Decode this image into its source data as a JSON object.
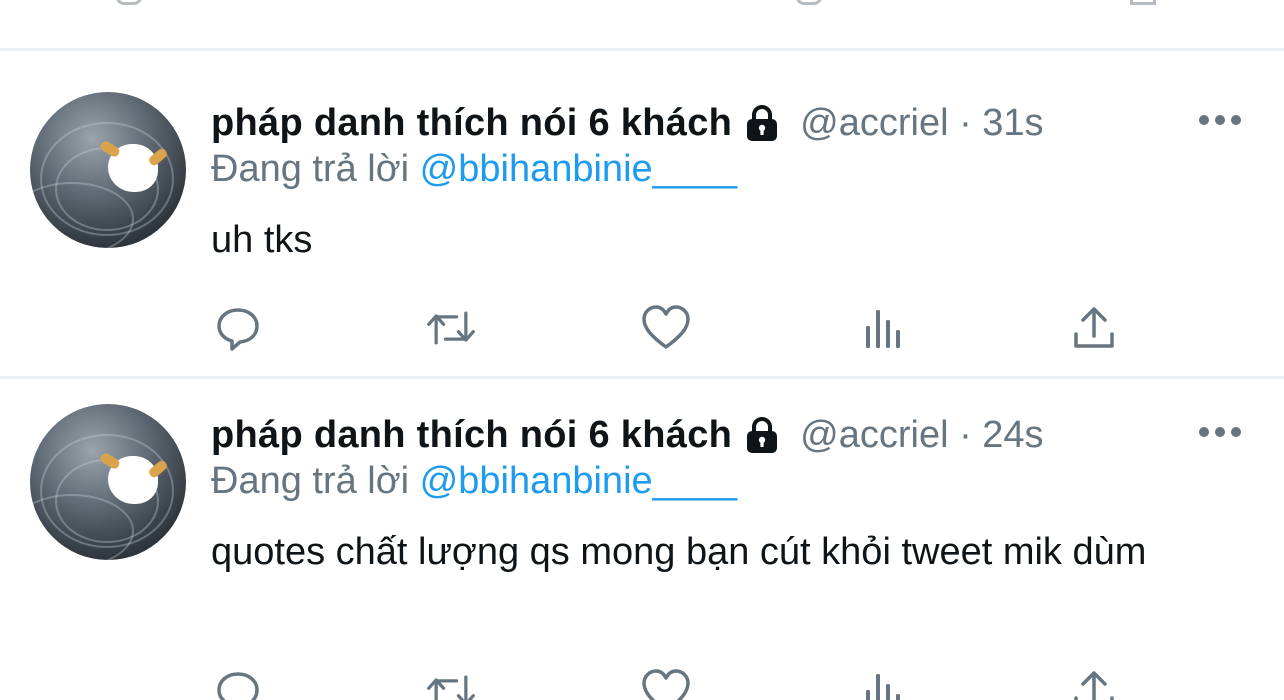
{
  "tweets": [
    {
      "display_name": "pháp danh thích nói 6 khách",
      "handle_time": "@accriel · 31s",
      "reply_prefix": "Đang trả lời",
      "reply_mention": "@bbihanbinie____",
      "text": "uh tks"
    },
    {
      "display_name": "pháp danh thích nói 6 khách",
      "handle_time": "@accriel · 24s",
      "reply_prefix": "Đang trả lời",
      "reply_mention": "@bbihanbinie____",
      "text": "quotes chất lượng qs mong bạn cút khỏi tweet mik dùm"
    }
  ],
  "icons": {
    "lock": "lock-icon",
    "more": "more-icon",
    "reply": "reply-icon",
    "retweet": "retweet-icon",
    "like": "heart-icon",
    "analytics": "analytics-icon",
    "share": "share-icon"
  },
  "colors": {
    "text": "#0f1419",
    "secondary": "#66757f",
    "mention": "#1d9bf0",
    "icon": "#66757f",
    "divider": "#eceff1"
  }
}
